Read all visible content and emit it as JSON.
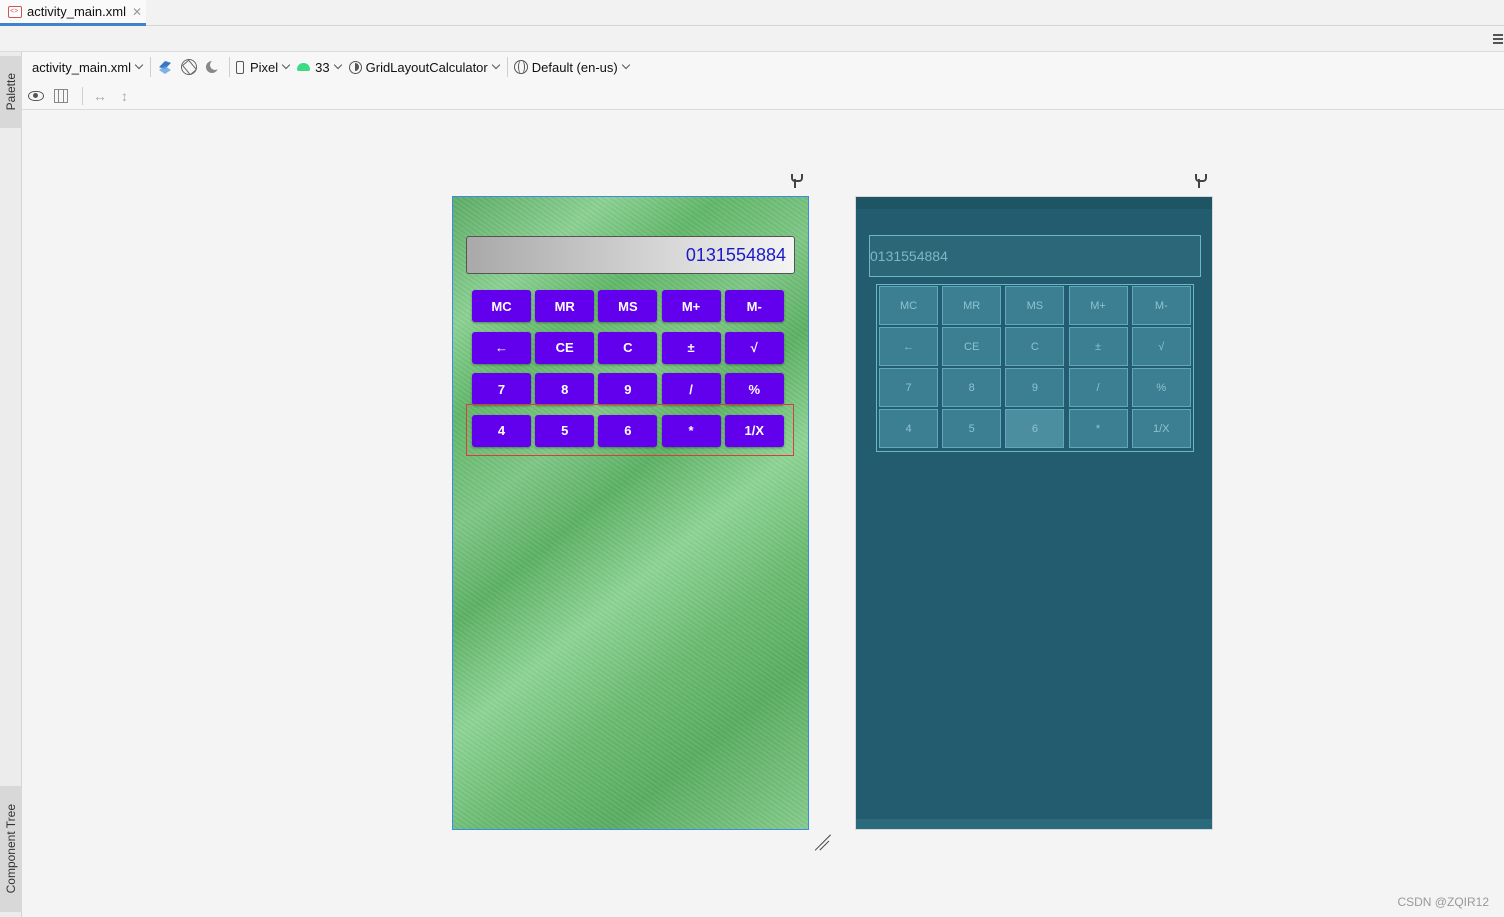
{
  "tabs": [
    {
      "label": "activity_main.xml"
    }
  ],
  "side_panel": {
    "palette_label": "Palette",
    "component_tree_label": "Component Tree"
  },
  "toolbar": {
    "file_select": "activity_main.xml",
    "device": "Pixel",
    "api_level": "33",
    "theme": "GridLayoutCalculator",
    "locale": "Default (en-us)",
    "icons": [
      "layers-icon",
      "orientation-icon",
      "night-mode-icon",
      "eye-icon",
      "columns-icon",
      "resize-horizontal-icon",
      "resize-vertical-icon"
    ]
  },
  "calculator": {
    "display_value": "0131554884",
    "rows": [
      [
        "MC",
        "MR",
        "MS",
        "M+",
        "M-"
      ],
      [
        "←",
        "CE",
        "C",
        "±",
        "√"
      ],
      [
        "7",
        "8",
        "9",
        "/",
        "%"
      ],
      [
        "4",
        "5",
        "6",
        "*",
        "1/X"
      ]
    ]
  },
  "blueprint": {
    "display_value": "0131554884",
    "rows": [
      [
        "MC",
        "MR",
        "MS",
        "M+",
        "M-"
      ],
      [
        "←",
        "CE",
        "C",
        "±",
        "√"
      ],
      [
        "7",
        "8",
        "9",
        "/",
        "%"
      ],
      [
        "4",
        "5",
        "6",
        "*",
        "1/X"
      ]
    ]
  },
  "colors": {
    "button": "#6200ee",
    "display_text": "#1a1ac8",
    "selection_outline": "#e03a3a",
    "blueprint_bg": "#225c6e"
  },
  "watermark": "CSDN @ZQIR12"
}
